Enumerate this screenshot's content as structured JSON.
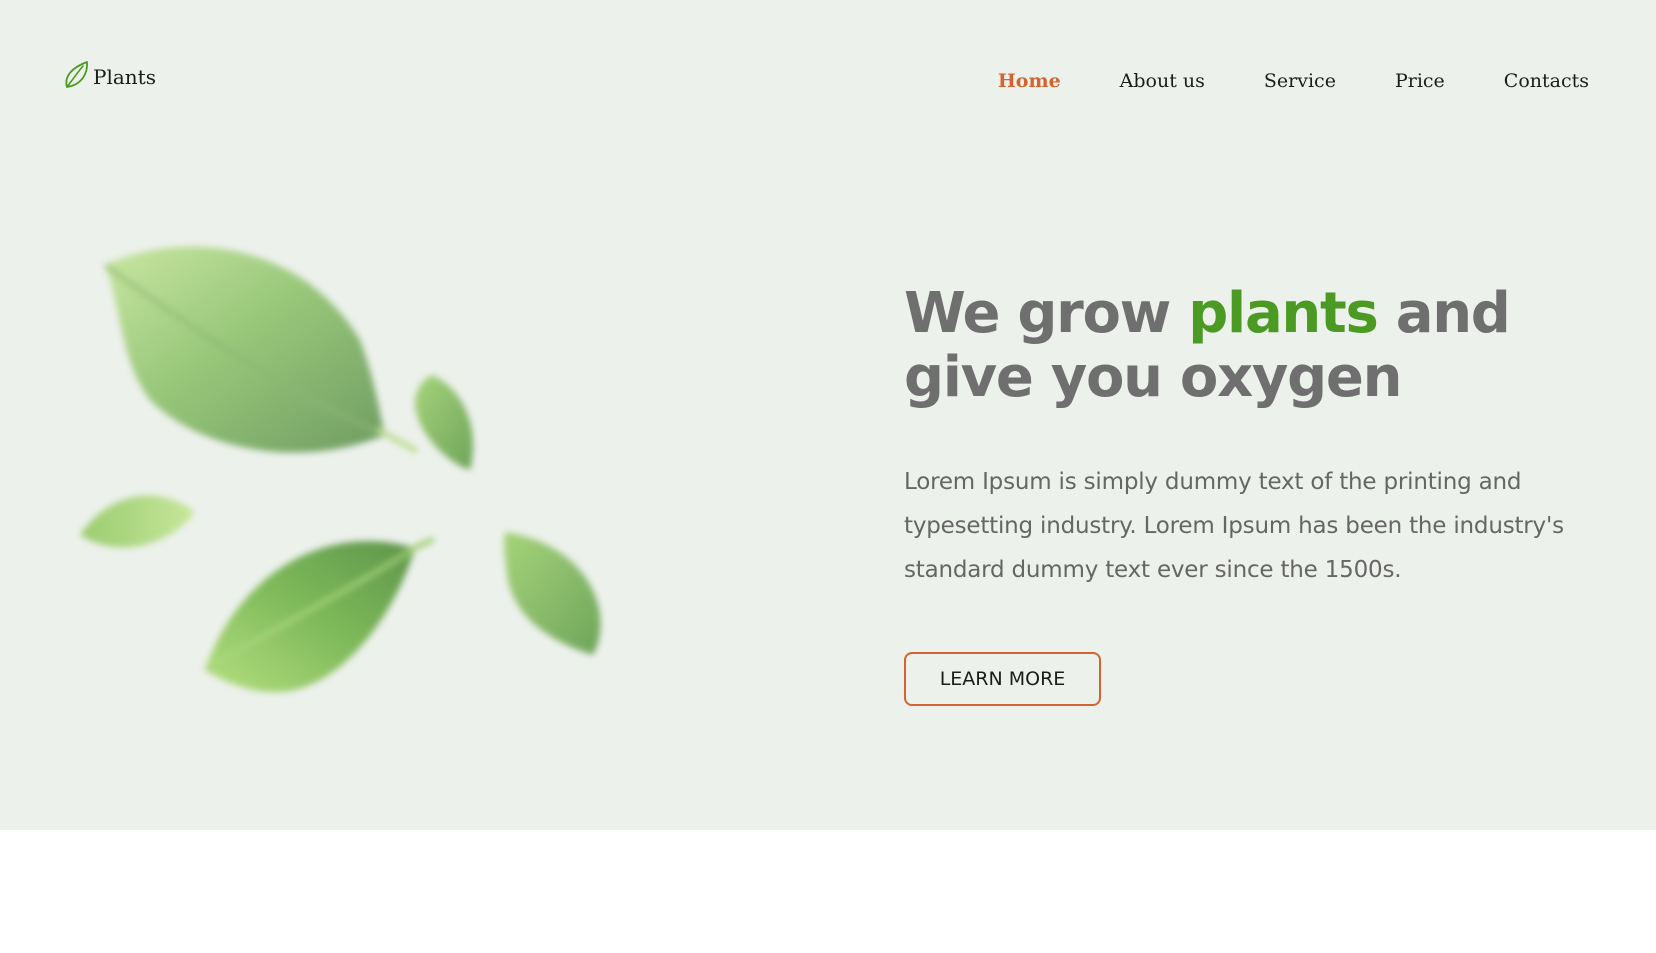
{
  "header": {
    "logo_text": "Plants",
    "logo_icon": "leaf-icon",
    "nav": [
      {
        "label": "Home",
        "active": true
      },
      {
        "label": "About us",
        "active": false
      },
      {
        "label": "Service",
        "active": false
      },
      {
        "label": "Price",
        "active": false
      },
      {
        "label": "Contacts",
        "active": false
      }
    ]
  },
  "hero": {
    "headline_before": "We grow ",
    "headline_accent": "plants",
    "headline_after": " and give you oxygen",
    "description": "Lorem Ipsum is simply dummy text of the printing and typesetting industry. Lorem Ipsum has been the industry's standard dummy text ever since the 1500s.",
    "cta_label": "LEARN MORE"
  },
  "colors": {
    "background": "#edf1ec",
    "accent_green": "#4a9a23",
    "accent_orange": "#d4632f",
    "heading_gray": "#6f6f6f"
  }
}
